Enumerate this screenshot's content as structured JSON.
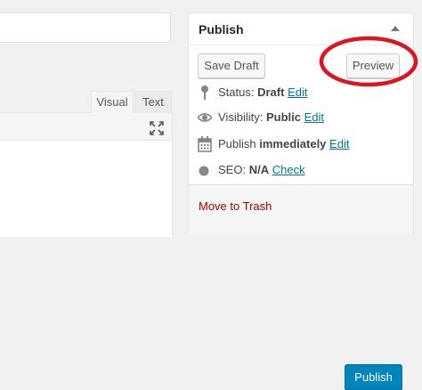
{
  "editor": {
    "tabs": {
      "visual": "Visual",
      "text": "Text"
    },
    "fullscreen_icon": "fullscreen-icon"
  },
  "publish_box": {
    "title": "Publish",
    "toggle_icon": "caret-up-icon",
    "save_draft_label": "Save Draft",
    "preview_label": "Preview",
    "status": {
      "label": "Status:",
      "value": "Draft",
      "action": "Edit",
      "icon": "pin-icon"
    },
    "visibility": {
      "label": "Visibility:",
      "value": "Public",
      "action": "Edit",
      "icon": "eye-icon"
    },
    "schedule": {
      "label": "Publish",
      "value": "immediately",
      "action": "Edit",
      "icon": "calendar-icon"
    },
    "seo": {
      "label": "SEO:",
      "value": "N/A",
      "action": "Check",
      "icon": "seo-dot-icon"
    },
    "trash_label": "Move to Trash",
    "publish_label": "Publish"
  },
  "annotation": {
    "highlight_color": "#e0141e"
  },
  "colors": {
    "accent": "#0085ba",
    "link": "#0073aa",
    "trash": "#aa0000"
  }
}
